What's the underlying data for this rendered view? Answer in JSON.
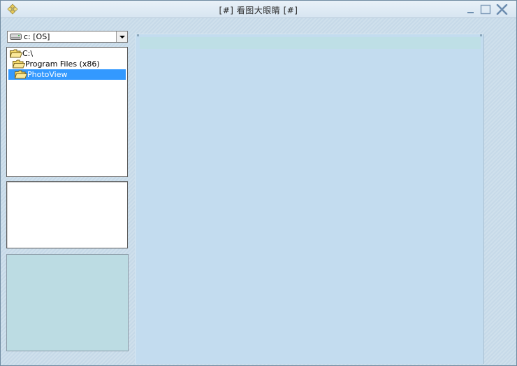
{
  "window": {
    "title": "[#] 看图大眼睛 [#]"
  },
  "colors": {
    "title_bar": "#dfeaf4",
    "client": "#c9dcea",
    "selection": "#3399ff",
    "preview_panel": "#bcdce3",
    "viewer": "#c3dcef"
  },
  "drive_selector": {
    "value": "c: [OS]",
    "icon": "drive-icon"
  },
  "folder_tree": {
    "items": [
      {
        "label": "C:\\",
        "icon": "folder-open-icon",
        "selected": false
      },
      {
        "label": "Program Files (x86)",
        "icon": "folder-open-icon",
        "selected": false
      },
      {
        "label": "PhotoView",
        "icon": "folder-open-icon",
        "selected": true
      }
    ]
  },
  "titlebar_buttons": [
    "minimize-icon",
    "maximize-icon",
    "close-icon"
  ]
}
